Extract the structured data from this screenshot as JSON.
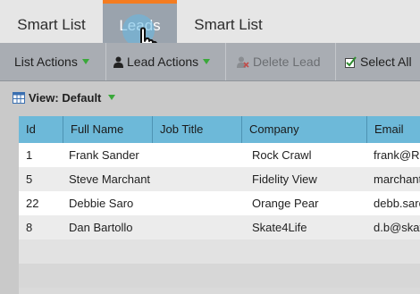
{
  "tabs": [
    {
      "label": "Smart List"
    },
    {
      "label": "Leads"
    },
    {
      "label": "Smart List"
    }
  ],
  "toolbar": {
    "list_actions": "List Actions",
    "lead_actions": "Lead Actions",
    "delete_lead": "Delete Lead",
    "select_all": "Select All"
  },
  "view": {
    "label": "View: Default"
  },
  "table": {
    "columns": [
      "Id",
      "Full Name",
      "Job Title",
      "Company",
      "Email"
    ],
    "rows": [
      {
        "id": "1",
        "full_name": "Frank Sander",
        "job_title": "",
        "company": "Rock Crawl",
        "email": "frank@Ro"
      },
      {
        "id": "5",
        "full_name": "Steve Marchant",
        "job_title": "",
        "company": "Fidelity View",
        "email": "marchant"
      },
      {
        "id": "22",
        "full_name": "Debbie Saro",
        "job_title": "",
        "company": "Orange Pear",
        "email": "debb.saro"
      },
      {
        "id": "8",
        "full_name": "Dan Bartollo",
        "job_title": "",
        "company": "Skate4Life",
        "email": "d.b@skat"
      }
    ]
  },
  "colors": {
    "active_tab_bg": "#9aa3ad",
    "active_tab_accent": "#f47c20",
    "header_blue": "#6db9d9",
    "dropdown_green": "#3aa83a"
  },
  "icons": {
    "lead_actions": "person-icon",
    "delete_lead": "delete-person-icon",
    "select_all": "checkbox-check-icon",
    "view": "grid-view-icon"
  }
}
